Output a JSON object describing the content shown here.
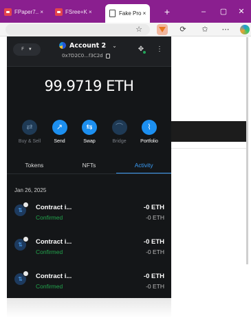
{
  "browser": {
    "tabs": [
      {
        "label": "FPaper7.. ×"
      },
      {
        "label": "FSree+K ×"
      },
      {
        "label": "Fake Pro ×"
      }
    ],
    "new_tab": "+",
    "window_controls": [
      "–",
      "▢",
      "✕"
    ]
  },
  "wallet": {
    "network_label": "F",
    "account_name": "Account 2",
    "address": "0x7D2C0...f3C2d",
    "balance": "99.9719 ETH",
    "actions": [
      {
        "label": "Buy & Sell",
        "icon": "buy-sell-icon",
        "glyph": "⇄",
        "enabled": false
      },
      {
        "label": "Send",
        "icon": "send-icon",
        "glyph": "↗",
        "enabled": true
      },
      {
        "label": "Swap",
        "icon": "swap-icon",
        "glyph": "⇆",
        "enabled": true
      },
      {
        "label": "Bridge",
        "icon": "bridge-icon",
        "glyph": "⌒",
        "enabled": false
      },
      {
        "label": "Portfolio",
        "icon": "portfolio-icon",
        "glyph": "⌇",
        "enabled": true
      }
    ],
    "tabs": [
      {
        "label": "Tokens",
        "active": false
      },
      {
        "label": "NFTs",
        "active": false
      },
      {
        "label": "Activity",
        "active": true
      }
    ],
    "date": "Jan 26, 2025",
    "transactions": [
      {
        "title": "Contract i...",
        "status": "Confirmed",
        "amount": "-0 ETH",
        "fiat": "-0 ETH"
      },
      {
        "title": "Contract i...",
        "status": "Confirmed",
        "amount": "-0 ETH",
        "fiat": "-0 ETH"
      },
      {
        "title": "Contract i...",
        "status": "Confirmed",
        "amount": "-0 ETH",
        "fiat": "-0 ETH"
      }
    ]
  },
  "colors": {
    "tabstrip": "#8a1f8f",
    "wallet_bg": "#141618",
    "accent": "#1c8ff0",
    "confirmed": "#22a24c"
  }
}
